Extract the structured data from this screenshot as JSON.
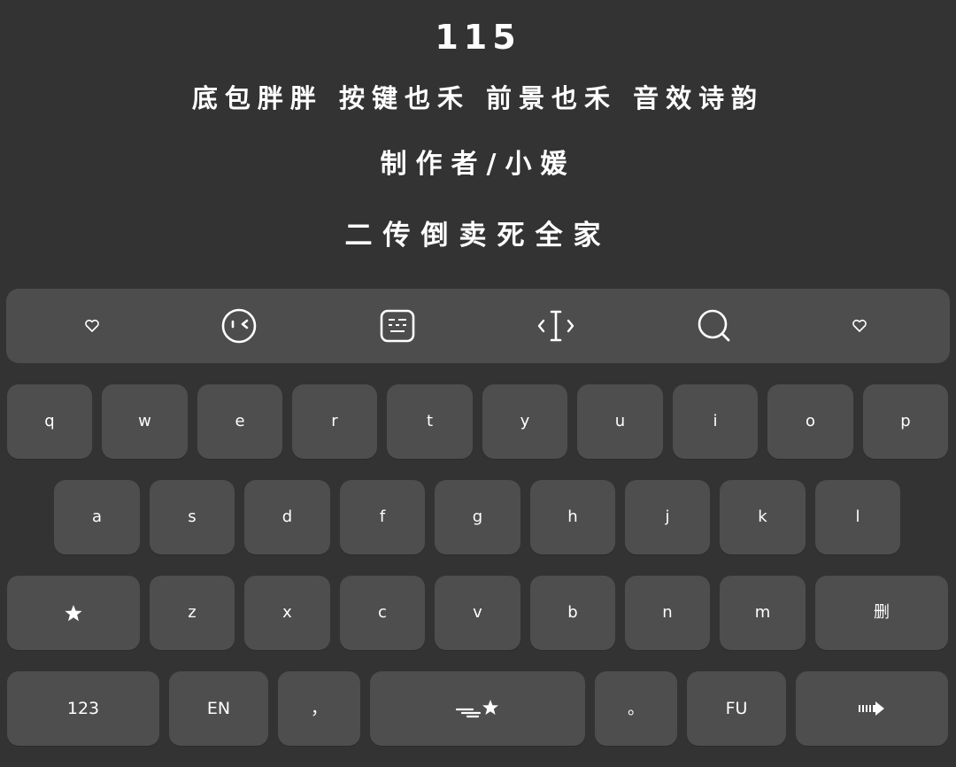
{
  "header": {
    "number": "115",
    "credits_line": "底包胖胖 按键也禾 前景也禾 音效诗韵",
    "maker_line": "制作者/小媛",
    "slogan_line": "二传倒卖死全家"
  },
  "toolbar": {
    "items": [
      {
        "icon": "heart-icon"
      },
      {
        "icon": "emoji-face-icon"
      },
      {
        "icon": "keyboard-layout-icon"
      },
      {
        "icon": "text-cursor-icon"
      },
      {
        "icon": "search-icon"
      },
      {
        "icon": "heart-icon"
      }
    ]
  },
  "keyboard": {
    "row1": [
      "q",
      "w",
      "e",
      "r",
      "t",
      "y",
      "u",
      "i",
      "o",
      "p"
    ],
    "row2": [
      "a",
      "s",
      "d",
      "f",
      "g",
      "h",
      "j",
      "k",
      "l"
    ],
    "row3": [
      "z",
      "x",
      "c",
      "v",
      "b",
      "n",
      "m"
    ],
    "shift_icon": "star-icon",
    "delete_label": "删",
    "numbers_label": "123",
    "lang_label": "EN",
    "comma_label": "，",
    "space_icon": "space-star-icon",
    "period_label": "。",
    "fu_label": "FU",
    "enter_icon": "arrow-right-icon"
  }
}
